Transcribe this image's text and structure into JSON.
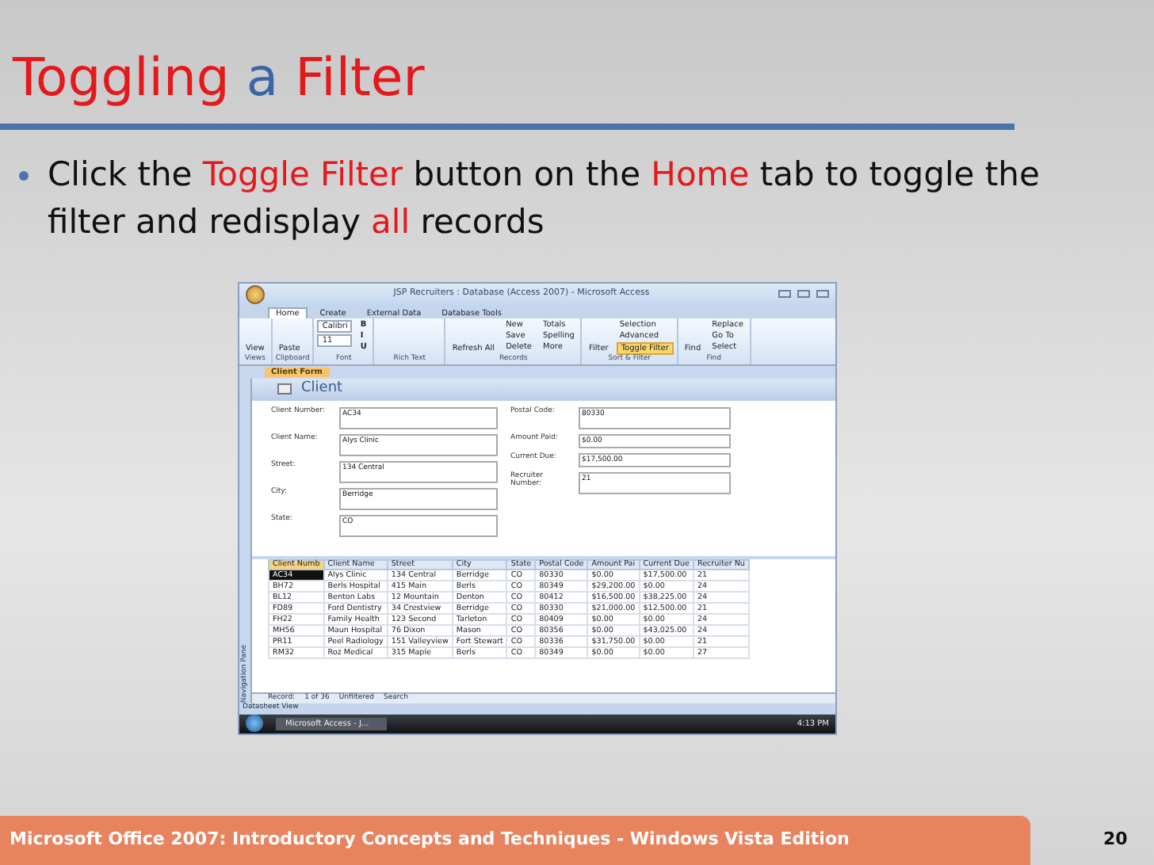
{
  "title": [
    {
      "text": "Toggling",
      "highlight": true
    },
    {
      "text": "a",
      "highlight": false
    },
    {
      "text": "Filter",
      "highlight": true
    }
  ],
  "bullets": [
    {
      "segments": [
        {
          "text": "Click the ",
          "highlight": false
        },
        {
          "text": "Toggle Filter",
          "highlight": true
        },
        {
          "text": " button on the ",
          "highlight": false
        },
        {
          "text": "Home",
          "highlight": true
        },
        {
          "text": " tab to toggle the filter and redisplay ",
          "highlight": false
        },
        {
          "text": "all",
          "highlight": true
        },
        {
          "text": " records",
          "highlight": false
        }
      ]
    }
  ],
  "screenshot": {
    "window_title": "JSP Recruiters : Database (Access 2007) - Microsoft Access",
    "ribbon_tabs": [
      {
        "label": "Home",
        "selected": true
      },
      {
        "label": "Create",
        "selected": false
      },
      {
        "label": "External Data",
        "selected": false
      },
      {
        "label": "Database Tools",
        "selected": false
      }
    ],
    "ribbon_groups": [
      {
        "label": "Views",
        "buttons": [
          {
            "label": "View",
            "kind": "large",
            "selected": false
          }
        ]
      },
      {
        "label": "Clipboard",
        "buttons": [
          {
            "label": "Paste",
            "kind": "large",
            "selected": false
          }
        ]
      },
      {
        "label": "Font",
        "buttons": [
          {
            "label": "Calibri",
            "kind": "field",
            "selected": false
          },
          {
            "label": "11",
            "kind": "field",
            "selected": false
          },
          {
            "label": "B",
            "kind": "glyph",
            "selected": false
          },
          {
            "label": "I",
            "kind": "glyph",
            "selected": false
          },
          {
            "label": "U",
            "kind": "glyph",
            "selected": false
          }
        ]
      },
      {
        "label": "Rich Text"
      },
      {
        "label": "Records",
        "buttons": [
          {
            "label": "Refresh All",
            "kind": "large",
            "selected": false
          },
          {
            "label": "New",
            "kind": "small",
            "selected": false
          },
          {
            "label": "Save",
            "kind": "small",
            "selected": false
          },
          {
            "label": "Delete",
            "kind": "small",
            "selected": false
          },
          {
            "label": "Totals",
            "kind": "small",
            "selected": false
          },
          {
            "label": "Spelling",
            "kind": "small",
            "selected": false
          },
          {
            "label": "More",
            "kind": "small",
            "selected": false
          }
        ]
      },
      {
        "label": "Sort & Filter",
        "buttons": [
          {
            "label": "Filter",
            "kind": "large",
            "selected": false
          },
          {
            "label": "Selection",
            "kind": "small",
            "selected": false
          },
          {
            "label": "Advanced",
            "kind": "small",
            "selected": false
          },
          {
            "label": "Toggle Filter",
            "kind": "small",
            "selected": true
          }
        ]
      },
      {
        "label": "Find",
        "buttons": [
          {
            "label": "Find",
            "kind": "large",
            "selected": false
          },
          {
            "label": "Replace",
            "kind": "small",
            "selected": false
          },
          {
            "label": "Go To",
            "kind": "small",
            "selected": false
          },
          {
            "label": "Select",
            "kind": "small",
            "selected": false
          }
        ]
      }
    ],
    "document_tab": "Client Form",
    "navigation_pane": "Navigation Pane",
    "form_title": "Client",
    "form_fields_left": [
      {
        "label": "Client Number:",
        "value": "AC34"
      },
      {
        "label": "Client Name:",
        "value": "Alys Clinic"
      },
      {
        "label": "Street:",
        "value": "134 Central"
      },
      {
        "label": "City:",
        "value": "Berridge"
      },
      {
        "label": "State:",
        "value": "CO"
      }
    ],
    "form_fields_right": [
      {
        "label": "Postal Code:",
        "value": "80330"
      },
      {
        "label": "Amount Paid:",
        "value": "$0.00"
      },
      {
        "label": "Current Due:",
        "value": "$17,500.00"
      },
      {
        "label": "Recruiter Number:",
        "value": "21"
      }
    ],
    "datasheet": {
      "columns": [
        "Client Numb",
        "Client Name",
        "Street",
        "City",
        "State",
        "Postal Code",
        "Amount Pai",
        "Current Due",
        "Recruiter Nu"
      ],
      "rows": [
        {
          "selected": true,
          "cells": [
            "AC34",
            "Alys Clinic",
            "134 Central",
            "Berridge",
            "CO",
            "80330",
            "$0.00",
            "$17,500.00",
            "21"
          ]
        },
        {
          "selected": false,
          "cells": [
            "BH72",
            "Berls Hospital",
            "415 Main",
            "Berls",
            "CO",
            "80349",
            "$29,200.00",
            "$0.00",
            "24"
          ]
        },
        {
          "selected": false,
          "cells": [
            "BL12",
            "Benton Labs",
            "12 Mountain",
            "Denton",
            "CO",
            "80412",
            "$16,500.00",
            "$38,225.00",
            "24"
          ]
        },
        {
          "selected": false,
          "cells": [
            "FD89",
            "Ford Dentistry",
            "34 Crestview",
            "Berridge",
            "CO",
            "80330",
            "$21,000.00",
            "$12,500.00",
            "21"
          ]
        },
        {
          "selected": false,
          "cells": [
            "FH22",
            "Family Health",
            "123 Second",
            "Tarleton",
            "CO",
            "80409",
            "$0.00",
            "$0.00",
            "24"
          ]
        },
        {
          "selected": false,
          "cells": [
            "MH56",
            "Maun Hospital",
            "76 Dixon",
            "Mason",
            "CO",
            "80356",
            "$0.00",
            "$43,025.00",
            "24"
          ]
        },
        {
          "selected": false,
          "cells": [
            "PR11",
            "Peel Radiology",
            "151 Valleyview",
            "Fort Stewart",
            "CO",
            "80336",
            "$31,750.00",
            "$0.00",
            "21"
          ]
        },
        {
          "selected": false,
          "cells": [
            "RM32",
            "Roz Medical",
            "315 Maple",
            "Berls",
            "CO",
            "80349",
            "$0.00",
            "$0.00",
            "27"
          ]
        }
      ]
    },
    "record_navigator": {
      "label": "Record:",
      "position": "1 of 36",
      "filter": "Unfiltered",
      "search": "Search"
    },
    "status_bar": "Datasheet View",
    "taskbar": {
      "button": "Microsoft Access - J...",
      "clock": "4:13 PM"
    }
  },
  "footer": {
    "text": "Microsoft Office 2007: Introductory Concepts and Techniques - Windows Vista Edition",
    "page": "20"
  }
}
